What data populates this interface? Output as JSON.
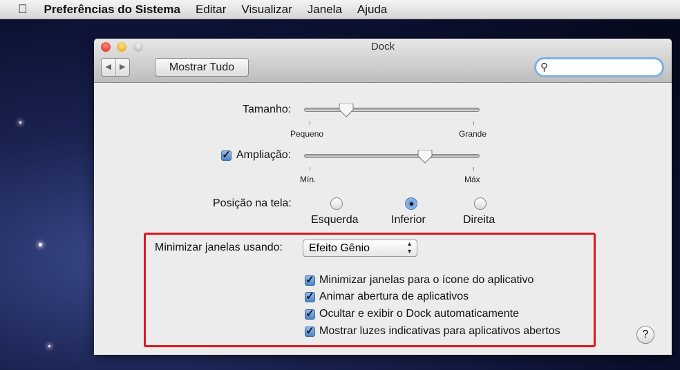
{
  "menubar": {
    "apple": "",
    "items": [
      "Preferências do Sistema",
      "Editar",
      "Visualizar",
      "Janela",
      "Ajuda"
    ]
  },
  "window": {
    "title": "Dock",
    "show_all": "Mostrar Tudo",
    "back": "◀",
    "forward": "▶",
    "search_placeholder": ""
  },
  "size": {
    "label": "Tamanho:",
    "min": "Pequeno",
    "max": "Grande",
    "value_percent": 24
  },
  "magnification": {
    "label": "Ampliação:",
    "checked": true,
    "min": "Mín.",
    "max": "Máx",
    "value_percent": 69
  },
  "position": {
    "label": "Posição na tela:",
    "options": [
      "Esquerda",
      "Inferior",
      "Direita"
    ],
    "selected": "Inferior"
  },
  "minimize": {
    "label": "Minimizar janelas usando:",
    "value": "Efeito Gênio"
  },
  "checkboxes": [
    {
      "label": "Minimizar janelas para o ícone do aplicativo",
      "checked": true
    },
    {
      "label": "Animar abertura de aplicativos",
      "checked": true
    },
    {
      "label": "Ocultar e exibir o Dock automaticamente",
      "checked": true
    },
    {
      "label": "Mostrar luzes indicativas para aplicativos abertos",
      "checked": true
    }
  ],
  "help": "?"
}
